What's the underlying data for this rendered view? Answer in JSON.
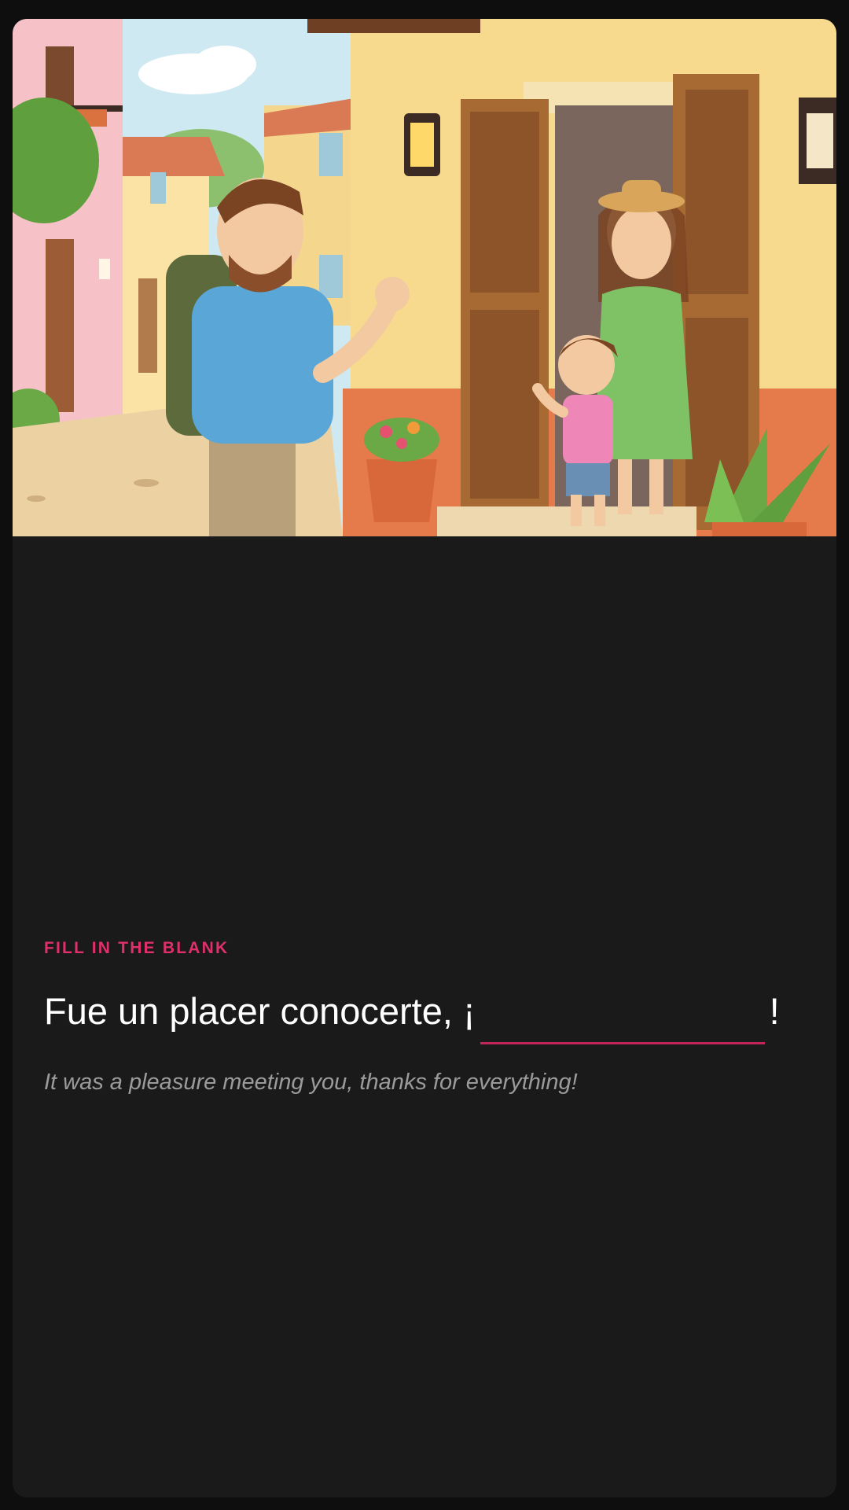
{
  "illustration": {
    "description_icon": "welcome-scene-illustration"
  },
  "exercise": {
    "tag": "FILL IN THE BLANK",
    "sentence_before": "Fue un placer conocerte, ¡",
    "sentence_after": "!",
    "blank_value": "",
    "translation": "It was a pleasure meeting you, thanks for everything!"
  },
  "colors": {
    "accent": "#e0306c",
    "underline": "#c2255c",
    "card_bg": "#1a1a1b",
    "page_bg": "#0e0e0f"
  }
}
